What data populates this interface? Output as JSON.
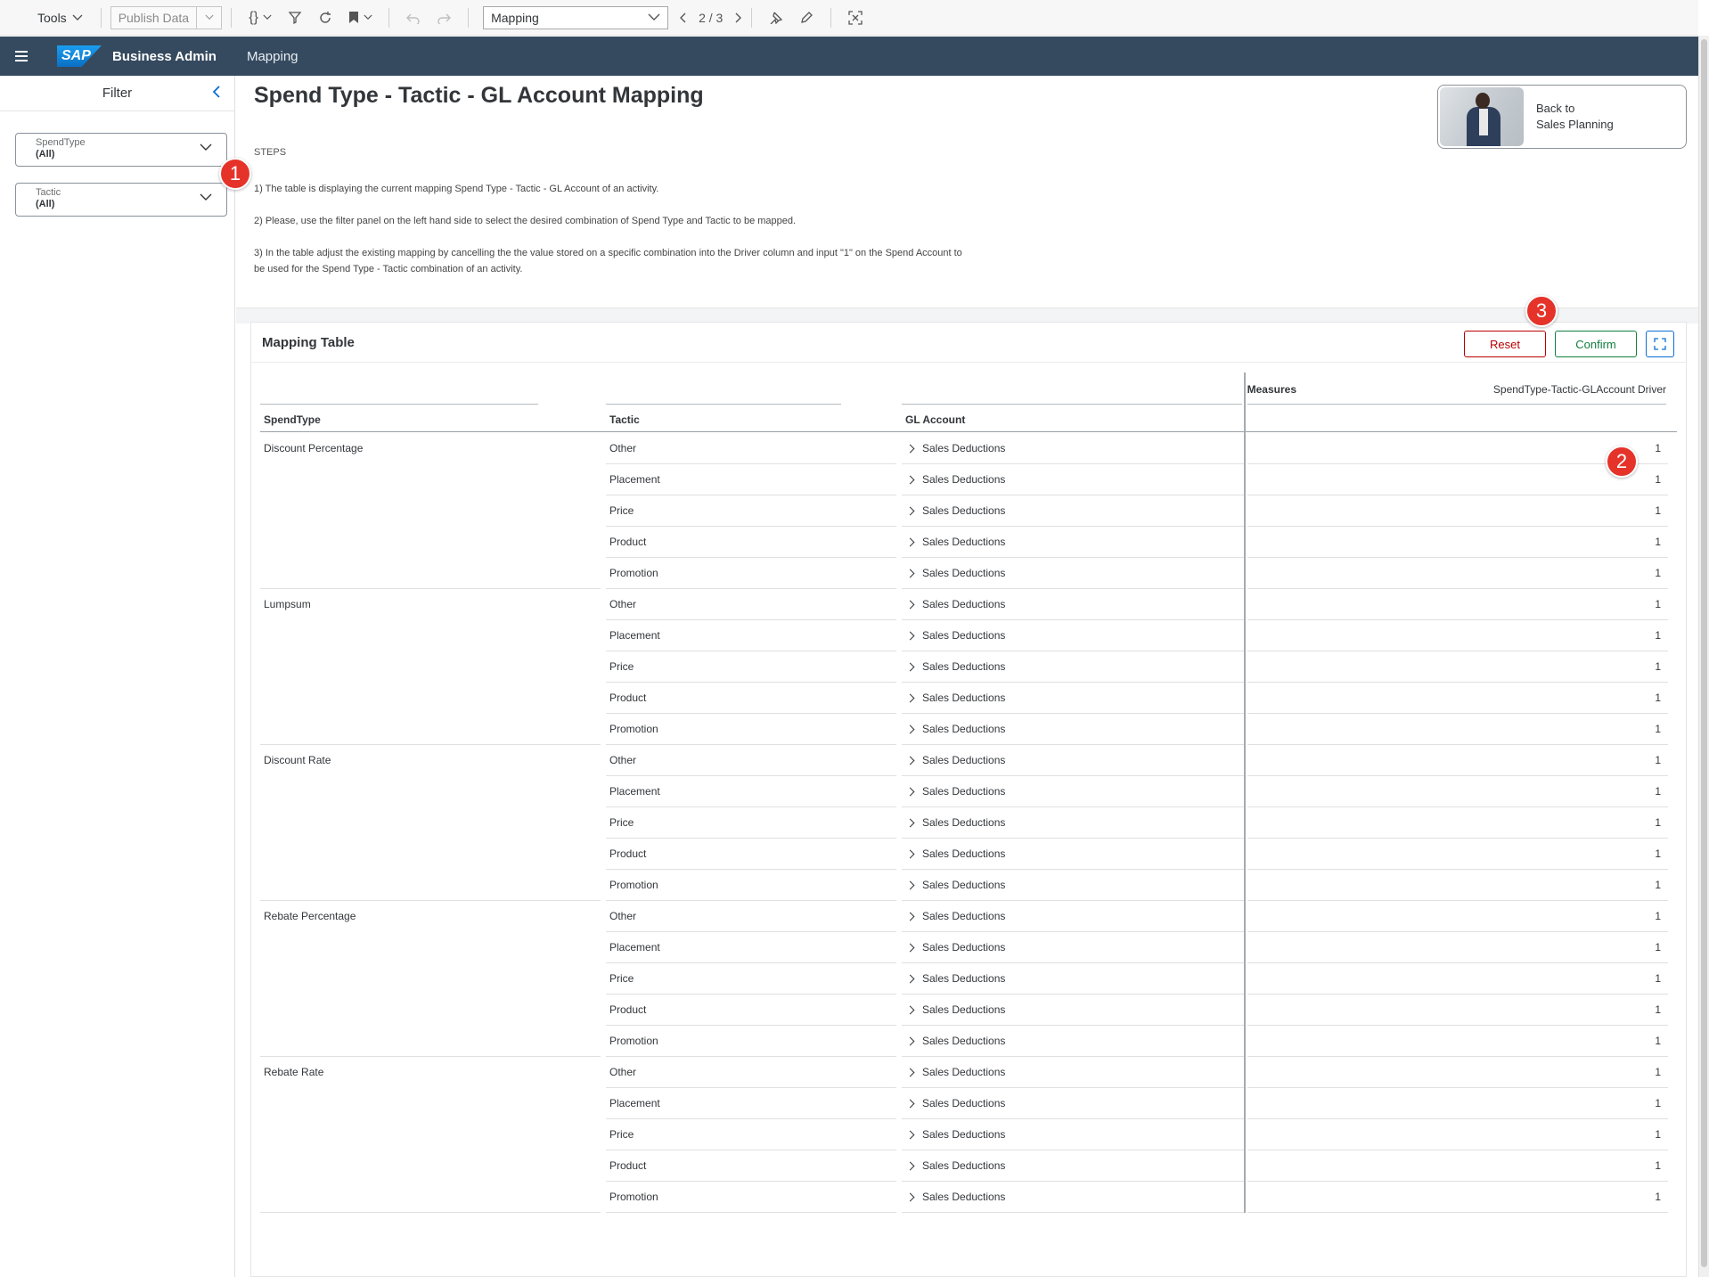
{
  "toolbar": {
    "tools_label": "Tools",
    "publish_label": "Publish Data",
    "story_page_select": "Mapping",
    "page_indicator": "2 / 3"
  },
  "shell": {
    "app_title": "Business Admin",
    "breadcrumb": "Mapping"
  },
  "filter_panel": {
    "title": "Filter",
    "filters": [
      {
        "label": "SpendType",
        "value": "(All)"
      },
      {
        "label": "Tactic",
        "value": "(All)"
      }
    ]
  },
  "main": {
    "title": "Spend Type - Tactic - GL Account Mapping",
    "steps_title": "STEPS",
    "steps": [
      "1) The table is displaying the current mapping Spend Type - Tactic - GL Account of an activity.",
      "2) Please, use the filter panel on the left hand side to select the desired combination of Spend Type and Tactic to be mapped.",
      "3) In the table adjust the existing mapping by cancelling the the value stored on a specific combination into the Driver column and input \"1\" on the Spend Account to be used for the Spend Type - Tactic combination of an activity."
    ],
    "back_card": {
      "line1": "Back to",
      "line2": "Sales Planning"
    }
  },
  "mapping_table": {
    "title": "Mapping Table",
    "reset_label": "Reset",
    "confirm_label": "Confirm",
    "measures_label": "Measures",
    "driver_header": "SpendType-Tactic-GLAccount Driver",
    "columns": {
      "spendtype": "SpendType",
      "tactic": "Tactic",
      "gl_account": "GL Account"
    },
    "rows": [
      {
        "spendtype": "Discount Percentage",
        "tactic": "Other",
        "gl": "Sales Deductions",
        "driver": "1"
      },
      {
        "spendtype": "",
        "tactic": "Placement",
        "gl": "Sales Deductions",
        "driver": "1"
      },
      {
        "spendtype": "",
        "tactic": "Price",
        "gl": "Sales Deductions",
        "driver": "1"
      },
      {
        "spendtype": "",
        "tactic": "Product",
        "gl": "Sales Deductions",
        "driver": "1"
      },
      {
        "spendtype": "",
        "tactic": "Promotion",
        "gl": "Sales Deductions",
        "driver": "1"
      },
      {
        "spendtype": "Lumpsum",
        "tactic": "Other",
        "gl": "Sales Deductions",
        "driver": "1"
      },
      {
        "spendtype": "",
        "tactic": "Placement",
        "gl": "Sales Deductions",
        "driver": "1"
      },
      {
        "spendtype": "",
        "tactic": "Price",
        "gl": "Sales Deductions",
        "driver": "1"
      },
      {
        "spendtype": "",
        "tactic": "Product",
        "gl": "Sales Deductions",
        "driver": "1"
      },
      {
        "spendtype": "",
        "tactic": "Promotion",
        "gl": "Sales Deductions",
        "driver": "1"
      },
      {
        "spendtype": "Discount Rate",
        "tactic": "Other",
        "gl": "Sales Deductions",
        "driver": "1"
      },
      {
        "spendtype": "",
        "tactic": "Placement",
        "gl": "Sales Deductions",
        "driver": "1"
      },
      {
        "spendtype": "",
        "tactic": "Price",
        "gl": "Sales Deductions",
        "driver": "1"
      },
      {
        "spendtype": "",
        "tactic": "Product",
        "gl": "Sales Deductions",
        "driver": "1"
      },
      {
        "spendtype": "",
        "tactic": "Promotion",
        "gl": "Sales Deductions",
        "driver": "1"
      },
      {
        "spendtype": "Rebate Percentage",
        "tactic": "Other",
        "gl": "Sales Deductions",
        "driver": "1"
      },
      {
        "spendtype": "",
        "tactic": "Placement",
        "gl": "Sales Deductions",
        "driver": "1"
      },
      {
        "spendtype": "",
        "tactic": "Price",
        "gl": "Sales Deductions",
        "driver": "1"
      },
      {
        "spendtype": "",
        "tactic": "Product",
        "gl": "Sales Deductions",
        "driver": "1"
      },
      {
        "spendtype": "",
        "tactic": "Promotion",
        "gl": "Sales Deductions",
        "driver": "1"
      },
      {
        "spendtype": "Rebate Rate",
        "tactic": "Other",
        "gl": "Sales Deductions",
        "driver": "1"
      },
      {
        "spendtype": "",
        "tactic": "Placement",
        "gl": "Sales Deductions",
        "driver": "1"
      },
      {
        "spendtype": "",
        "tactic": "Price",
        "gl": "Sales Deductions",
        "driver": "1"
      },
      {
        "spendtype": "",
        "tactic": "Product",
        "gl": "Sales Deductions",
        "driver": "1"
      },
      {
        "spendtype": "",
        "tactic": "Promotion",
        "gl": "Sales Deductions",
        "driver": "1"
      }
    ]
  },
  "annotations": [
    "1",
    "2",
    "3"
  ],
  "icons": {
    "toolbar": [
      "chevron-down-icon",
      "code-braces-icon",
      "filter-icon",
      "refresh-icon",
      "bookmark-icon",
      "undo-icon",
      "redo-icon",
      "pin-icon",
      "edit-icon",
      "fullscreen-icon"
    ],
    "shell": [
      "hamburger-icon",
      "sap-logo"
    ]
  },
  "colors": {
    "shell_bg": "#354a5f",
    "reset": "#bb0000",
    "confirm": "#107e3e",
    "accent": "#0a6ed1",
    "badge": "#e5332a"
  }
}
